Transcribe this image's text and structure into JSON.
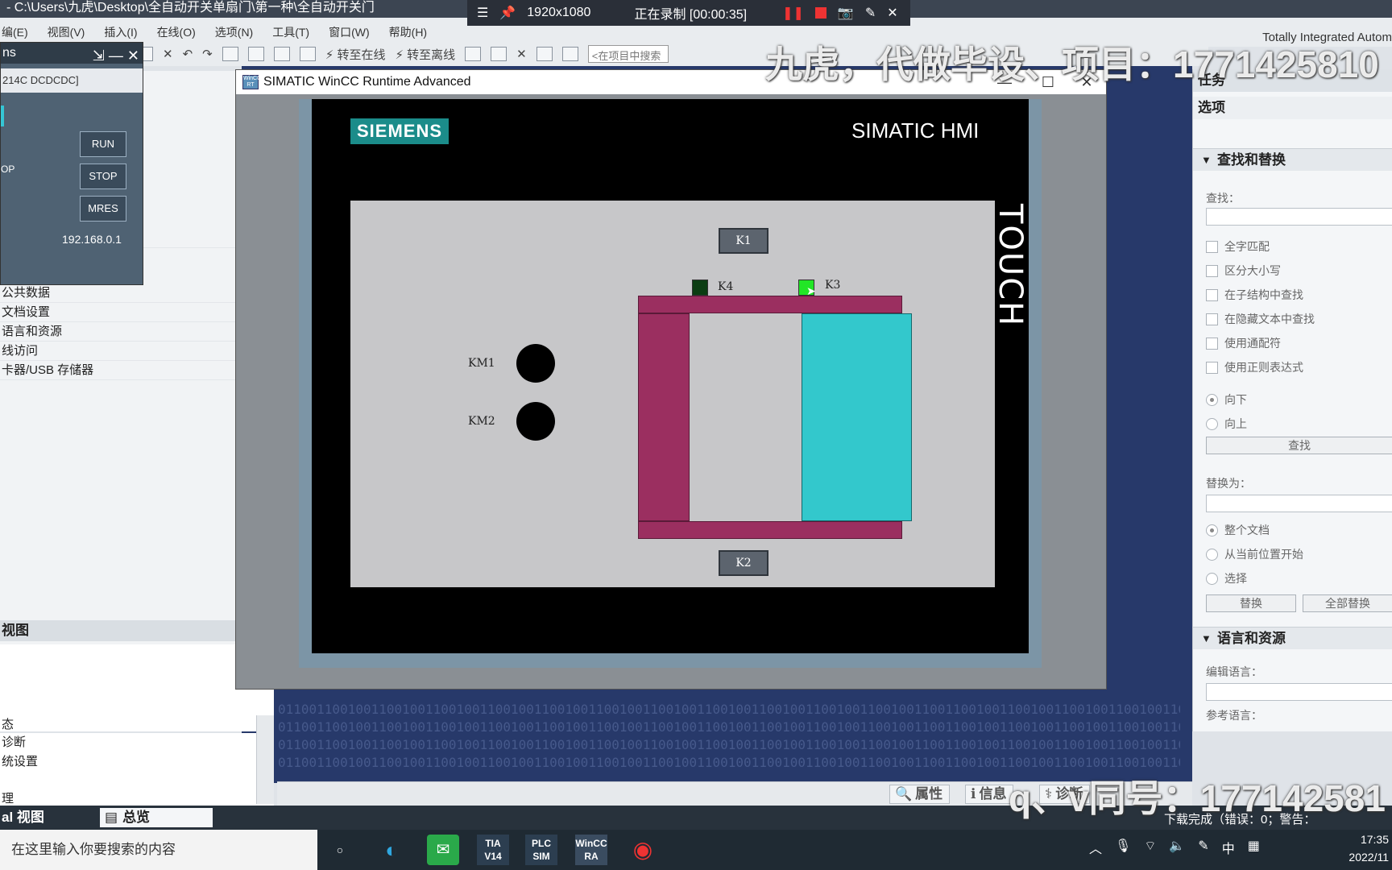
{
  "tia": {
    "window_title": "- C:\\Users\\九虎\\Desktop\\全自动开关单扇门\\第一种\\全自动开关门",
    "brand": "Totally Integrated Autom",
    "menus": [
      "编(E)",
      "视图(V)",
      "插入(I)",
      "在线(O)",
      "选项(N)",
      "工具(T)",
      "窗口(W)",
      "帮助(H)"
    ],
    "toolbar": {
      "go_online": "转至在线",
      "go_offline": "转至离线",
      "search_placeholder": "<在项目中搜索>"
    }
  },
  "recorder": {
    "resolution": "1920x1080",
    "status": "正在录制 [00:00:35]"
  },
  "watermark": {
    "top": "九虎，代做毕设、项目：1771425810",
    "bottom": "q、v同号：177142581"
  },
  "plcsim": {
    "title": "ns",
    "model": "214C DCDCDC]",
    "op_label": "OP",
    "run": "RUN",
    "stop": "STOP",
    "mres": "MRES",
    "ip": "192.168.0.1"
  },
  "project_tree": {
    "items": [
      "C]",
      "公共数据",
      "文档设置",
      "语言和资源",
      "线访问",
      "卡器/USB 存储器"
    ],
    "view_header": "视图",
    "lower_items": [
      "态",
      "诊断",
      "统设置",
      "理"
    ]
  },
  "wincc": {
    "title": "SIMATIC WinCC Runtime Advanced",
    "logo_text": "WinCC RT",
    "siemens": "SIEMENS",
    "hmi_brand": "SIMATIC HMI",
    "touch": "TOUCH",
    "screen": {
      "k1": "K1",
      "k2": "K2",
      "k3": "K3",
      "k4": "K4",
      "km1": "KM1",
      "km2": "KM2",
      "colors": {
        "k4_lamp": "#0b3d12",
        "k3_lamp": "#22e626",
        "frame": "#9b2f60",
        "door": "#33c8cc",
        "km_lamp": "#000000"
      }
    }
  },
  "tasks_panel": {
    "title": "任务",
    "options": "选项",
    "find_replace": {
      "header": "查找和替换",
      "find_label": "查找：",
      "checks": [
        "全字匹配",
        "区分大小写",
        "在子结构中查找",
        "在隐藏文本中查找",
        "使用通配符",
        "使用正则表达式"
      ],
      "dir_down": "向下",
      "dir_up": "向上",
      "find_button": "查找",
      "replace_label": "替换为：",
      "scope": [
        "整个文档",
        "从当前位置开始",
        "选择"
      ],
      "replace_button": "替换",
      "replace_all_button": "全部替换"
    },
    "lang_res": {
      "header": "语言和资源",
      "edit_lang": "编辑语言：",
      "ref_lang": "参考语言："
    }
  },
  "inspector": {
    "properties": "属性",
    "info": "信息",
    "diagnostics": "诊断"
  },
  "portal": {
    "view": "al 视图",
    "overview": "总览",
    "download": "下载完成（错误：0；警告："
  },
  "taskbar": {
    "search": "在这里输入你要搜索的内容",
    "apps": [
      "TIA V14",
      "PLC SIM",
      "WinCC RA"
    ],
    "ime": "中",
    "time": "17:35",
    "date": "2022/11"
  },
  "binary": "0110011001001100100110010011001001100100110010011001001100100110010011001001100100110011001001100100110010011001001100100110"
}
